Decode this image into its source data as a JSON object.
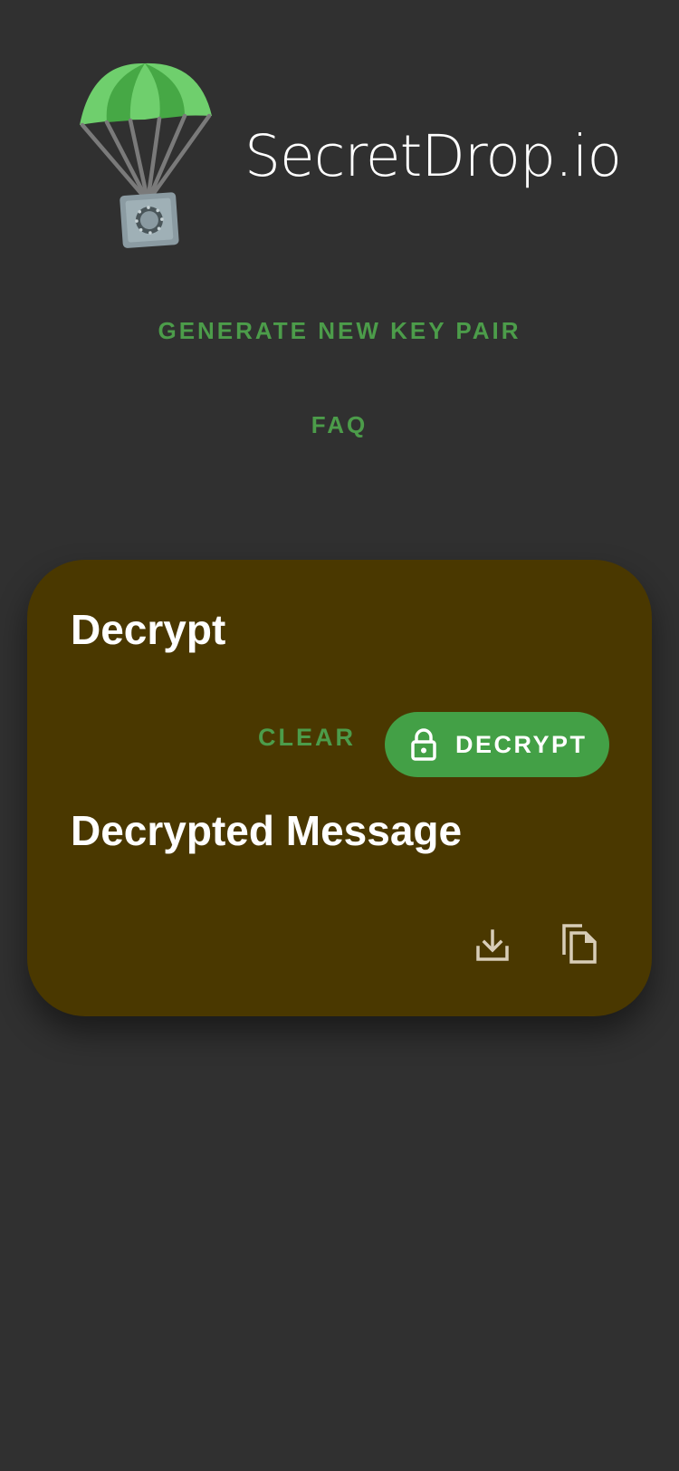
{
  "app": {
    "title": "SecretDrop.io",
    "logo_icon": "parachute-safe-icon"
  },
  "nav": {
    "generate_label": "GENERATE NEW KEY PAIR",
    "faq_label": "FAQ"
  },
  "card": {
    "decrypt_heading": "Decrypt",
    "clear_label": "CLEAR",
    "decrypt_button_label": "DECRYPT",
    "decrypt_button_icon": "lock-icon",
    "decrypted_heading": "Decrypted Message",
    "download_icon": "download-icon",
    "copy_icon": "copy-icon"
  },
  "colors": {
    "background": "#303030",
    "card": "#4a3800",
    "accent_green": "#4c9c4a",
    "button_green": "#43a046",
    "icon_tan": "#d8cdb8"
  }
}
